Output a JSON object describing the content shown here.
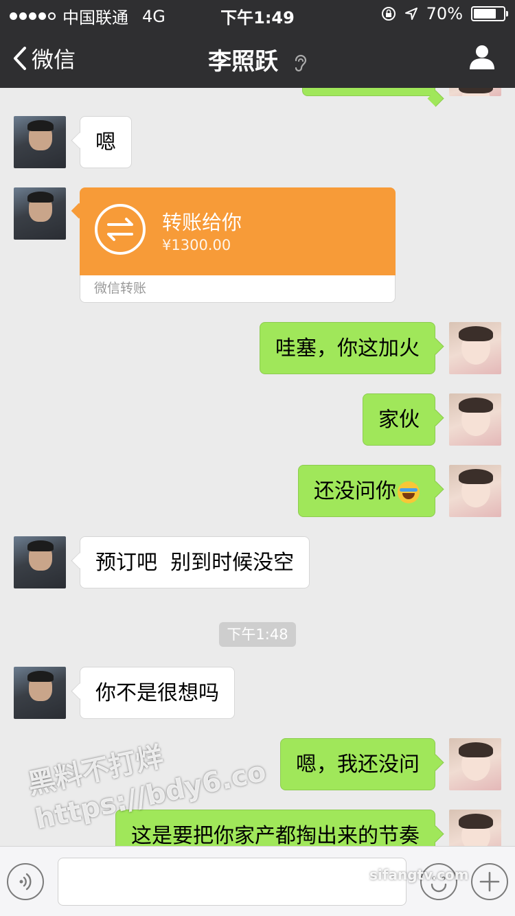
{
  "status_bar": {
    "carrier": "中国联通",
    "network": "4G",
    "time": "下午1:49",
    "battery": "70%",
    "battery_level": 0.7
  },
  "nav": {
    "back_label": "微信",
    "title": "李照跃"
  },
  "messages": {
    "m1": "嗯",
    "transfer": {
      "title": "转账给你",
      "amount": "¥1300.00",
      "footer": "微信转账"
    },
    "m2": "哇塞，你这加火",
    "m3": "家伙",
    "m4": "还没问你",
    "m5": "预订吧  别到时候没空",
    "timestamp": "下午1:48",
    "m6": "你不是很想吗",
    "m7": "嗯，我还没问",
    "m8": "这是要把你家产都掏出来的节奏"
  },
  "watermarks": {
    "line1": "黑料不打烊",
    "line2": "https://bdy6.co",
    "corner": "sifangtv.com"
  },
  "colors": {
    "topbar": "#2f2f31",
    "background": "#ebebeb",
    "outgoing_bubble": "#a0e75a",
    "incoming_bubble": "#ffffff",
    "transfer": "#f79b38"
  }
}
